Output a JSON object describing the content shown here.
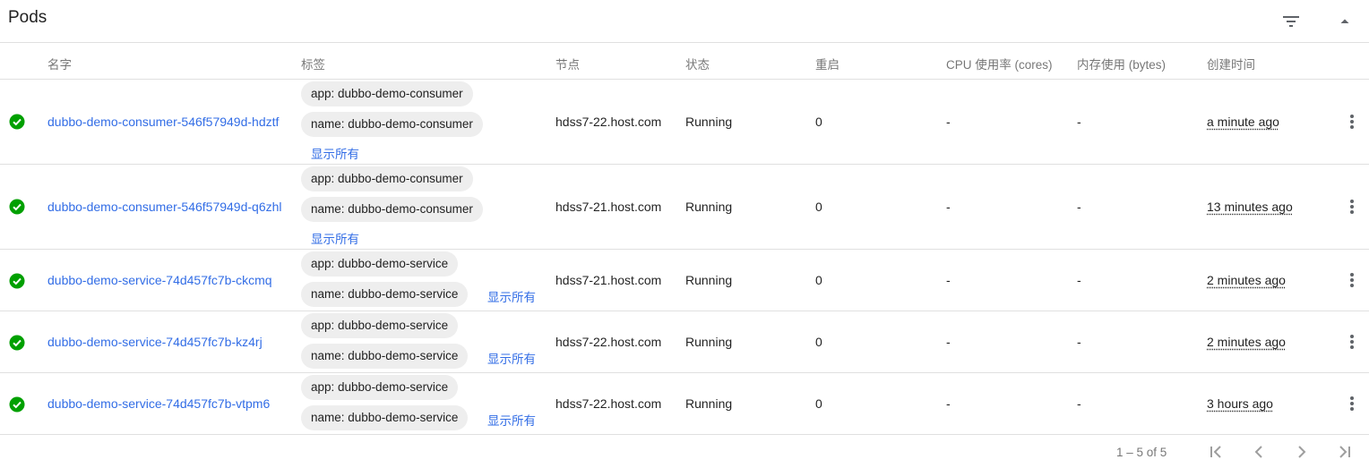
{
  "header": {
    "title": "Pods",
    "filter_icon": "filter-list-icon",
    "collapse_icon": "expand-less-icon"
  },
  "columns": {
    "name": "名字",
    "labels": "标签",
    "node": "节点",
    "status": "状态",
    "restarts": "重启",
    "cpu": "CPU 使用率 (cores)",
    "memory": "内存使用 (bytes)",
    "created": "创建时间"
  },
  "rows": [
    {
      "name": "dubbo-demo-consumer-546f57949d-hdztf",
      "labels": [
        "app: dubbo-demo-consumer",
        "name: dubbo-demo-consumer"
      ],
      "show_all": "显示所有",
      "node": "hdss7-22.host.com",
      "status": "Running",
      "restarts": "0",
      "cpu": "-",
      "memory": "-",
      "created": "a minute ago"
    },
    {
      "name": "dubbo-demo-consumer-546f57949d-q6zhl",
      "labels": [
        "app: dubbo-demo-consumer",
        "name: dubbo-demo-consumer"
      ],
      "show_all": "显示所有",
      "node": "hdss7-21.host.com",
      "status": "Running",
      "restarts": "0",
      "cpu": "-",
      "memory": "-",
      "created": "13 minutes ago"
    },
    {
      "name": "dubbo-demo-service-74d457fc7b-ckcmq",
      "labels": [
        "app: dubbo-demo-service",
        "name: dubbo-demo-service"
      ],
      "show_all": "显示所有",
      "node": "hdss7-21.host.com",
      "status": "Running",
      "restarts": "0",
      "cpu": "-",
      "memory": "-",
      "created": "2 minutes ago"
    },
    {
      "name": "dubbo-demo-service-74d457fc7b-kz4rj",
      "labels": [
        "app: dubbo-demo-service",
        "name: dubbo-demo-service"
      ],
      "show_all": "显示所有",
      "node": "hdss7-22.host.com",
      "status": "Running",
      "restarts": "0",
      "cpu": "-",
      "memory": "-",
      "created": "2 minutes ago"
    },
    {
      "name": "dubbo-demo-service-74d457fc7b-vtpm6",
      "labels": [
        "app: dubbo-demo-service",
        "name: dubbo-demo-service"
      ],
      "show_all": "显示所有",
      "node": "hdss7-22.host.com",
      "status": "Running",
      "restarts": "0",
      "cpu": "-",
      "memory": "-",
      "created": "3 hours ago"
    }
  ],
  "paginator": {
    "range_label": "1 – 5 of 5",
    "icons": [
      "first-page-icon",
      "chevron-left-icon",
      "chevron-right-icon",
      "last-page-icon"
    ]
  },
  "colors": {
    "link": "#326de6",
    "success": "#00a000",
    "chip_bg": "#eeeeee",
    "divider": "#e0e0e0"
  }
}
